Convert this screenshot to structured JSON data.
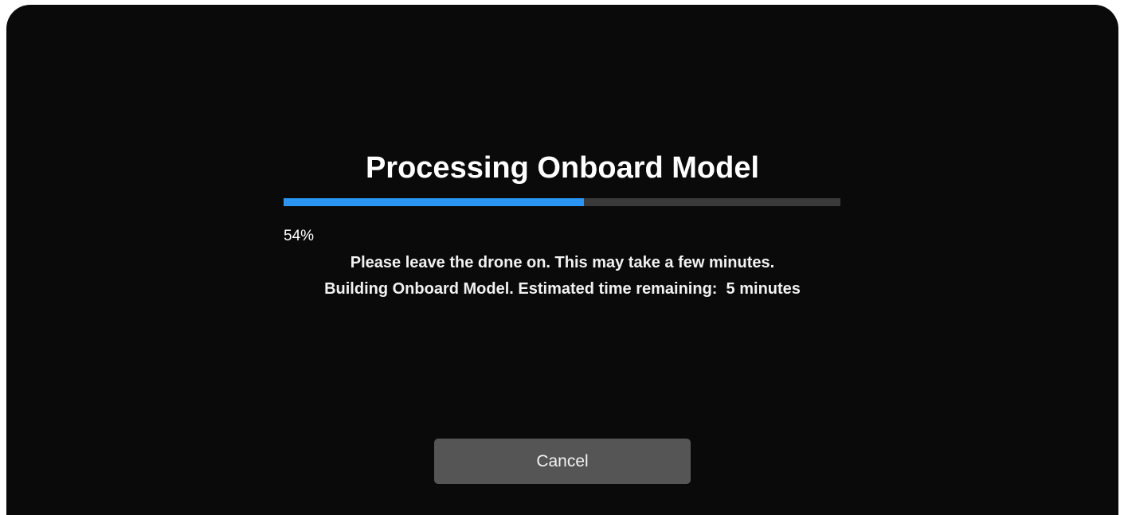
{
  "dialog": {
    "title": "Processing Onboard Model",
    "progress_percent": 54,
    "percent_label": "54%",
    "message_line1": "Please leave the drone on. This may take a few minutes.",
    "message_line2": "Building Onboard Model. Estimated time remaining:  5 minutes",
    "cancel_label": "Cancel"
  },
  "colors": {
    "background": "#0a0a0a",
    "progress_fill": "#2a95f3",
    "progress_track": "#3a3a3a",
    "button": "#555555"
  }
}
